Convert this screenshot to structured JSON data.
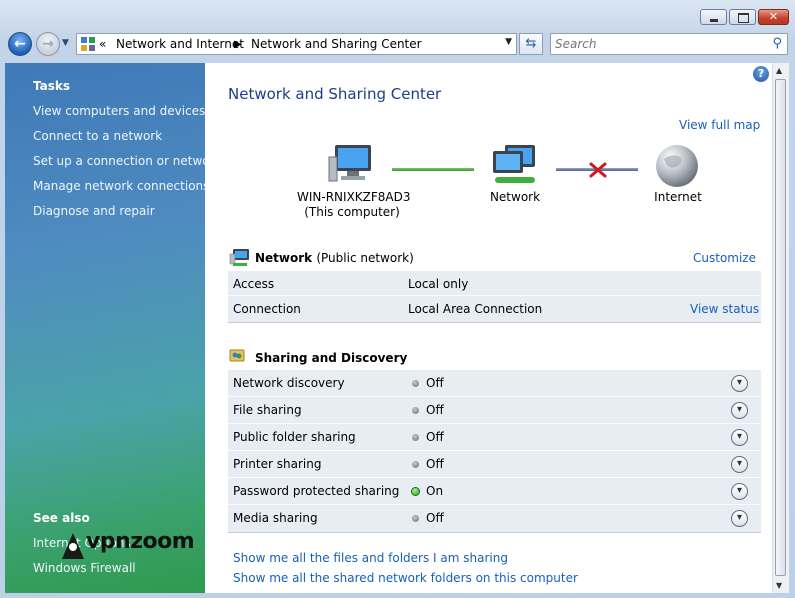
{
  "window": {
    "minimize_glyph": "",
    "close_glyph": "✕"
  },
  "nav": {
    "breadcrumb": [
      "Network and Internet",
      "Network and Sharing Center"
    ],
    "search_placeholder": "Search"
  },
  "sidebar": {
    "tasks_heading": "Tasks",
    "tasks": [
      "View computers and devices",
      "Connect to a network",
      "Set up a connection or network",
      "Manage network connections",
      "Diagnose and repair"
    ],
    "see_also_heading": "See also",
    "see_also": [
      "Internet Options",
      "Windows Firewall"
    ]
  },
  "watermark": {
    "text": "vpnzoom"
  },
  "main": {
    "title": "Network and Sharing Center",
    "view_full_map": "View full map",
    "map": {
      "computer_name": "WIN-RNIXKZF8AD3",
      "computer_sub": "(This computer)",
      "network_label": "Network",
      "internet_label": "Internet"
    },
    "network": {
      "name": "Network",
      "type": "(Public network)",
      "customize": "Customize",
      "rows": [
        {
          "label": "Access",
          "value": "Local only"
        },
        {
          "label": "Connection",
          "value": "Local Area Connection",
          "action": "View status"
        }
      ]
    },
    "sharing": {
      "heading": "Sharing and Discovery",
      "rows": [
        {
          "label": "Network discovery",
          "state": "Off"
        },
        {
          "label": "File sharing",
          "state": "Off"
        },
        {
          "label": "Public folder sharing",
          "state": "Off"
        },
        {
          "label": "Printer sharing",
          "state": "Off"
        },
        {
          "label": "Password protected sharing",
          "state": "On"
        },
        {
          "label": "Media sharing",
          "state": "Off"
        }
      ]
    },
    "links": [
      "Show me all the files and folders I am sharing",
      "Show me all the shared network folders on this computer"
    ]
  },
  "colors": {
    "link": "#1560bd",
    "title": "#1c3c8c",
    "annotation_arrow": "#c0392b"
  }
}
